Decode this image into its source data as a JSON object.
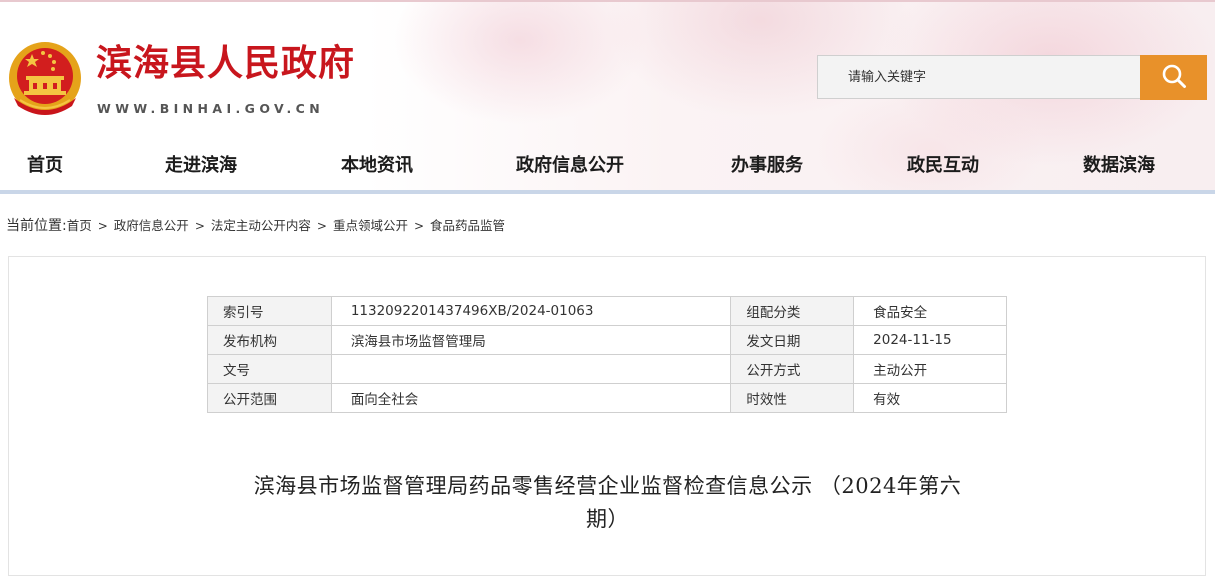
{
  "header": {
    "site_title": "滨海县人民政府",
    "site_domain": "WWW.BINHAI.GOV.CN",
    "emblem_icon": "national-emblem-icon",
    "search": {
      "placeholder": "请输入关键字",
      "button_icon": "search-icon"
    },
    "accent_color": "#c8161d",
    "search_button_color": "#e8912a"
  },
  "nav": {
    "items": [
      {
        "label": "首页"
      },
      {
        "label": "走进滨海"
      },
      {
        "label": "本地资讯"
      },
      {
        "label": "政府信息公开"
      },
      {
        "label": "办事服务"
      },
      {
        "label": "政民互动"
      },
      {
        "label": "数据滨海"
      }
    ]
  },
  "breadcrumb": {
    "lead": "当前位置:",
    "items": [
      "首页",
      "政府信息公开",
      "法定主动公开内容",
      "重点领域公开",
      "食品药品监管"
    ],
    "separator": ">"
  },
  "meta_table": {
    "rows": [
      {
        "k1": "索引号",
        "v1": "113209220143749​6XB/2024-01063",
        "k2": "组配分类",
        "v2": "食品安全"
      },
      {
        "k1": "发布机构",
        "v1": "滨海县市场监督管理局",
        "k2": "发文日期",
        "v2": "2024-11-15"
      },
      {
        "k1": "文号",
        "v1": "",
        "k2": "公开方式",
        "v2": "主动公开"
      },
      {
        "k1": "公开范围",
        "v1": "面向全社会",
        "k2": "时效性",
        "v2": "有效"
      }
    ]
  },
  "article": {
    "title_line1": "滨海县市场监督管理局药品零售经营企业监督检查信息公示 （2024年第六",
    "title_line2": "期）"
  }
}
